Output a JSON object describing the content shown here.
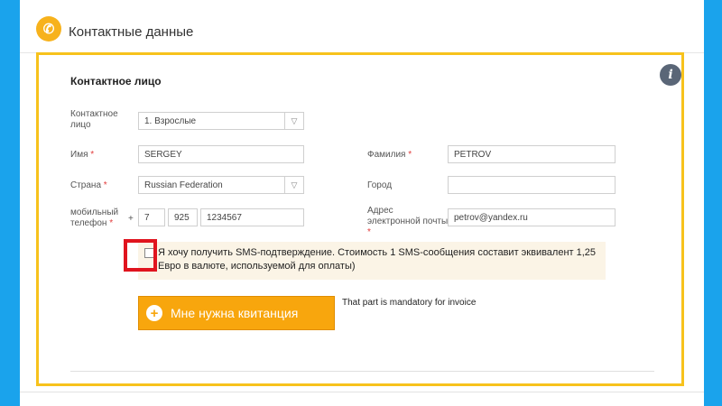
{
  "header": {
    "title": "Контактные данные",
    "icon": "phone-icon"
  },
  "contact": {
    "section_title": "Контактное лицо",
    "person_label": "Контактное лицо",
    "person_value": "1. Взрослые",
    "first_name_label": "Имя",
    "first_name_value": "SERGEY",
    "last_name_label": "Фамилия",
    "last_name_value": "PETROV",
    "country_label": "Страна",
    "country_value": "Russian Federation",
    "city_label": "Город",
    "city_value": "",
    "phone_label": "мобильный телефон",
    "phone_plus": "+",
    "phone_code": "7",
    "phone_operator": "925",
    "phone_number": "1234567",
    "email_label": "Адрес электронной почты",
    "email_value": "petrov@yandex.ru",
    "required_mark": "*"
  },
  "sms": {
    "checked": false,
    "text": "Я хочу получить SMS-подтверждение. Стоимость 1 SMS-сообщения составит эквивалент 1,25 Евро в валюте, используемой для оплаты)"
  },
  "receipt": {
    "button_label": "Мне нужна квитанция",
    "note": "That part is mandatory for invoice"
  },
  "info_button": "i",
  "colors": {
    "background": "#1aa3ec",
    "accent": "#f7b21c",
    "highlight": "#e0141e"
  }
}
